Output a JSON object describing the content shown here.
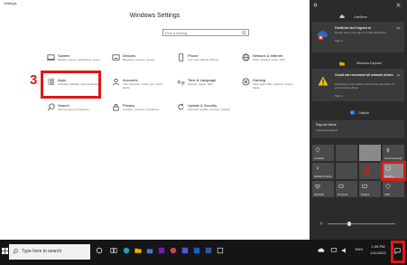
{
  "window": {
    "title": "Settings",
    "heading": "Windows Settings"
  },
  "search": {
    "placeholder": "Find a setting"
  },
  "tiles": [
    {
      "title": "System",
      "subtitle": "Display, sound, notifications, power"
    },
    {
      "title": "Devices",
      "subtitle": "Bluetooth, printers, mouse"
    },
    {
      "title": "Phone",
      "subtitle": "Link your Android, iPhone"
    },
    {
      "title": "Network & Internet",
      "subtitle": "Wi-Fi, airplane mode, VPN"
    },
    {
      "title": "Apps",
      "subtitle": "Uninstall, defaults, optional features"
    },
    {
      "title": "Accounts",
      "subtitle": "Your accounts, email, sync, work, family"
    },
    {
      "title": "Time & Language",
      "subtitle": "Speech, region, date"
    },
    {
      "title": "Gaming",
      "subtitle": "Xbox Game Bar, captures, Game Mode"
    },
    {
      "title": "Search",
      "subtitle": "Find my files, permissions"
    },
    {
      "title": "Privacy",
      "subtitle": "Location, camera, microphone"
    },
    {
      "title": "Update & Security",
      "subtitle": "Windows Update, recovery, backup"
    }
  ],
  "steps": {
    "apps_step": "3",
    "quick_action_step": "2"
  },
  "action_center": {
    "onedrive_header": "OneDrive",
    "onedrive_title": "OneDrive isn't signed in",
    "onedrive_body": "Please enter your sign in to start OneDrive",
    "onedrive_link": "Sign in",
    "explorer_header": "Windows Explorer",
    "explorer_title": "Could not reconnect all network drives",
    "explorer_body": "Click here to see which could not be reconnect to your network drives.",
    "explorer_link": "Sign in",
    "outlook_header": "Outlook",
    "paylah_title": "PayLah! Alerts",
    "paylah_body": "Transaction Alerts",
    "quick_actions": [
      "Location",
      "",
      "",
      "Connected (2)",
      "Mobile hotspot",
      "",
      "",
      "Nearby...",
      "Network",
      "Connect",
      "Project",
      "VPN"
    ]
  },
  "taskbar": {
    "search_placeholder": "Type here to search",
    "time": "1:05 PM",
    "date": "1/11/2022",
    "language": "ENG"
  },
  "colors": {
    "highlight": "#e01717",
    "action_center_bg": "#2b2b2b",
    "taskbar_bg": "#151515"
  }
}
